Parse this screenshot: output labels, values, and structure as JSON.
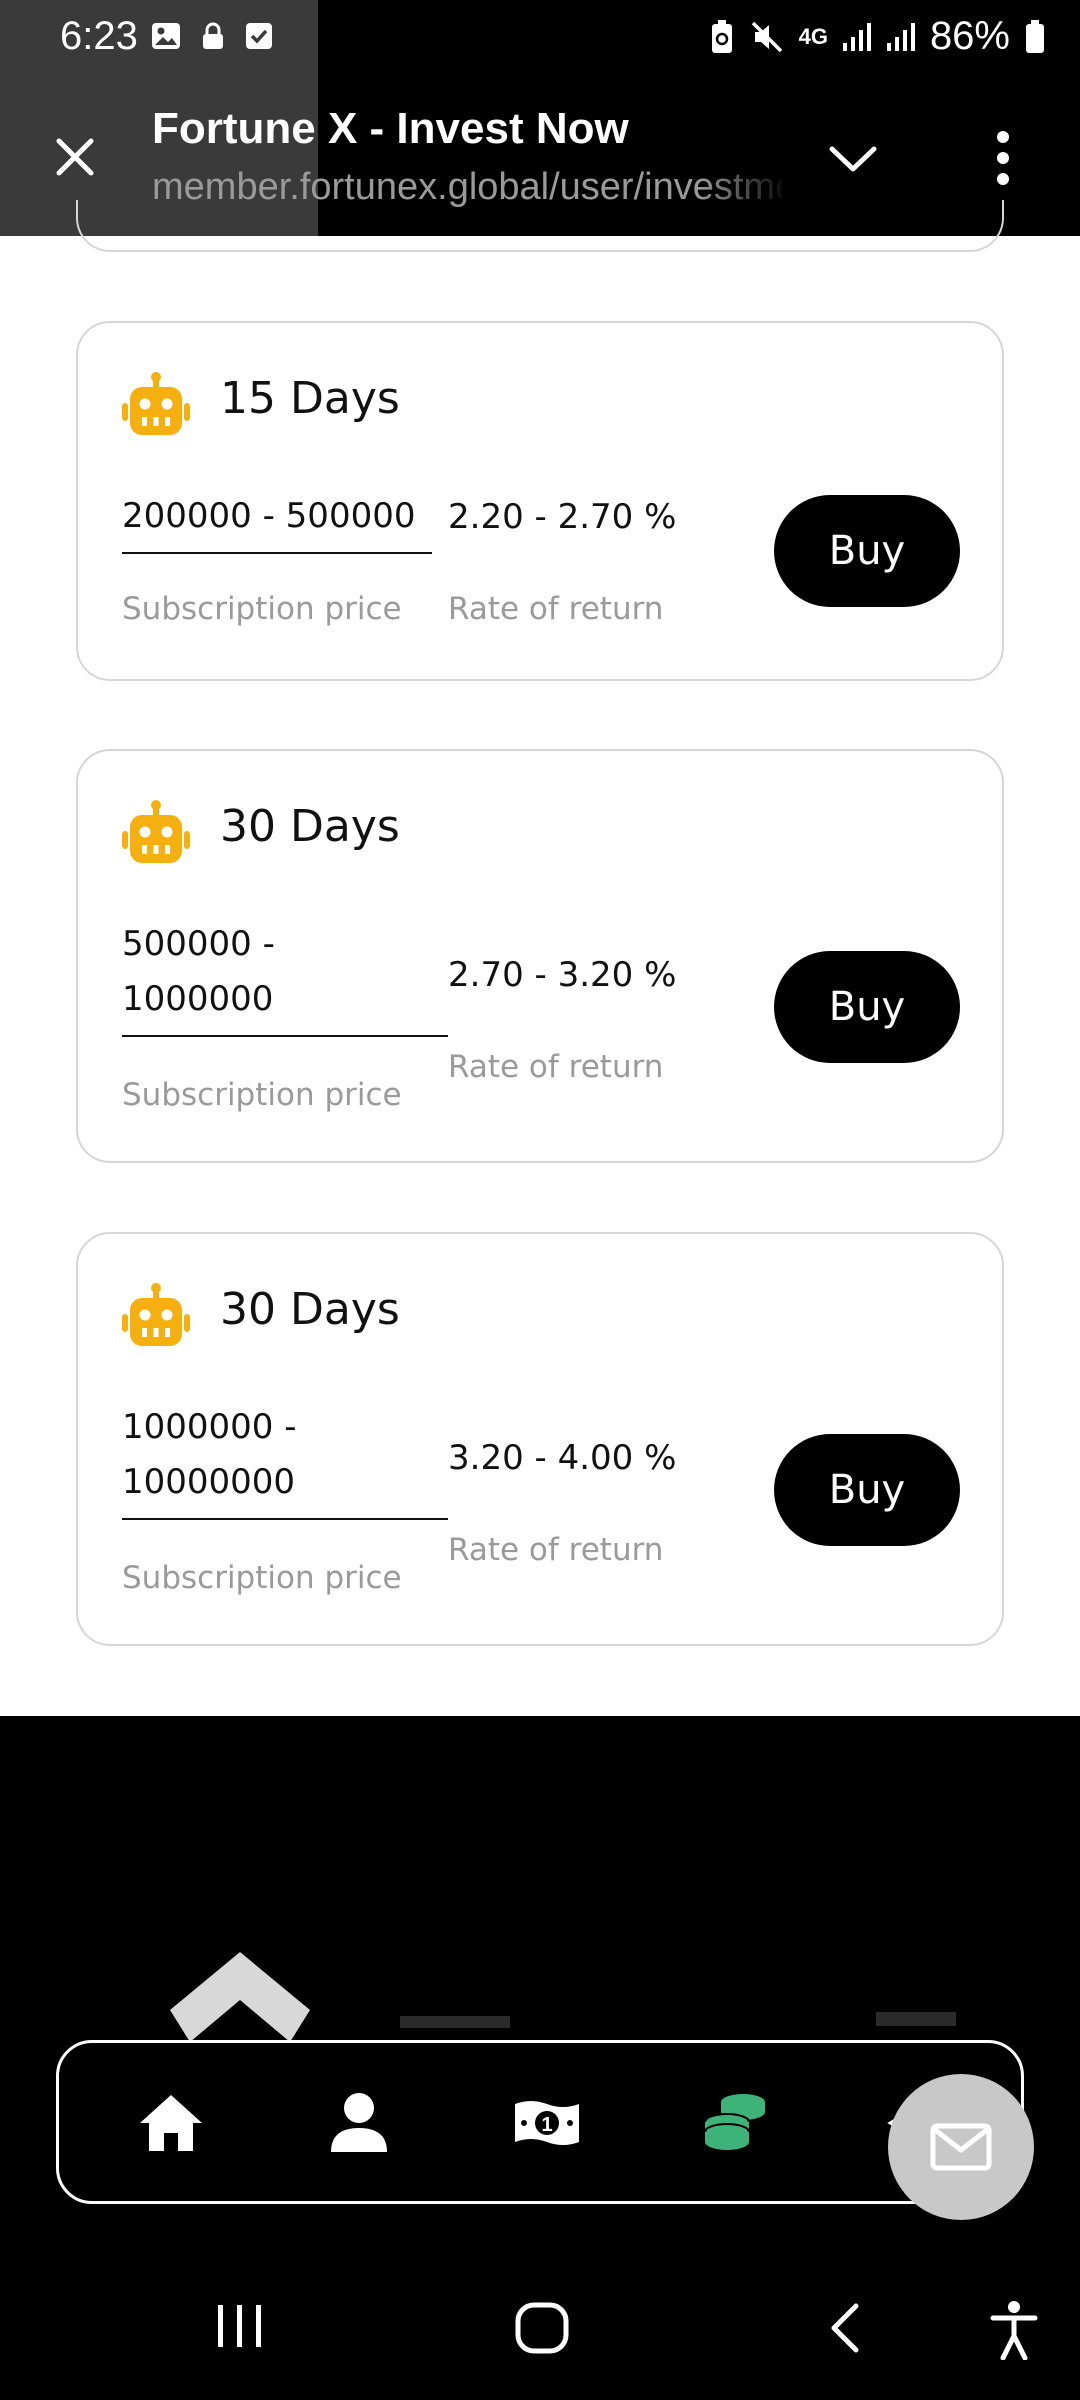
{
  "status_bar": {
    "time": "6:23",
    "battery": "86%",
    "network": "4G"
  },
  "browser": {
    "title": "Fortune X - Invest Now",
    "url": "member.fortunex.global/user/investme"
  },
  "plans": [
    {
      "days": "15 Days",
      "price": "200000 - 500000",
      "price_label": "Subscription price",
      "rate": "2.20 - 2.70 %",
      "rate_label": "Rate of return",
      "buy_label": "Buy"
    },
    {
      "days": "30 Days",
      "price_line1": "500000 -",
      "price_line2": "1000000",
      "price_label": "Subscription price",
      "rate": "2.70 - 3.20 %",
      "rate_label": "Rate of return",
      "buy_label": "Buy"
    },
    {
      "days": "30 Days",
      "price_line1": "1000000 -",
      "price_line2": "10000000",
      "price_label": "Subscription price",
      "rate": "3.20 - 4.00 %",
      "rate_label": "Rate of return",
      "buy_label": "Buy"
    }
  ],
  "bottom_nav": {
    "items": [
      "home-icon",
      "user-icon",
      "money-icon",
      "coins-icon",
      "share-icon"
    ],
    "active": "coins-icon"
  },
  "colors": {
    "robot": "#F5B00F",
    "active_nav": "#3DB37A",
    "buy_button": "#000000",
    "label_gray": "#9A9A9A"
  }
}
